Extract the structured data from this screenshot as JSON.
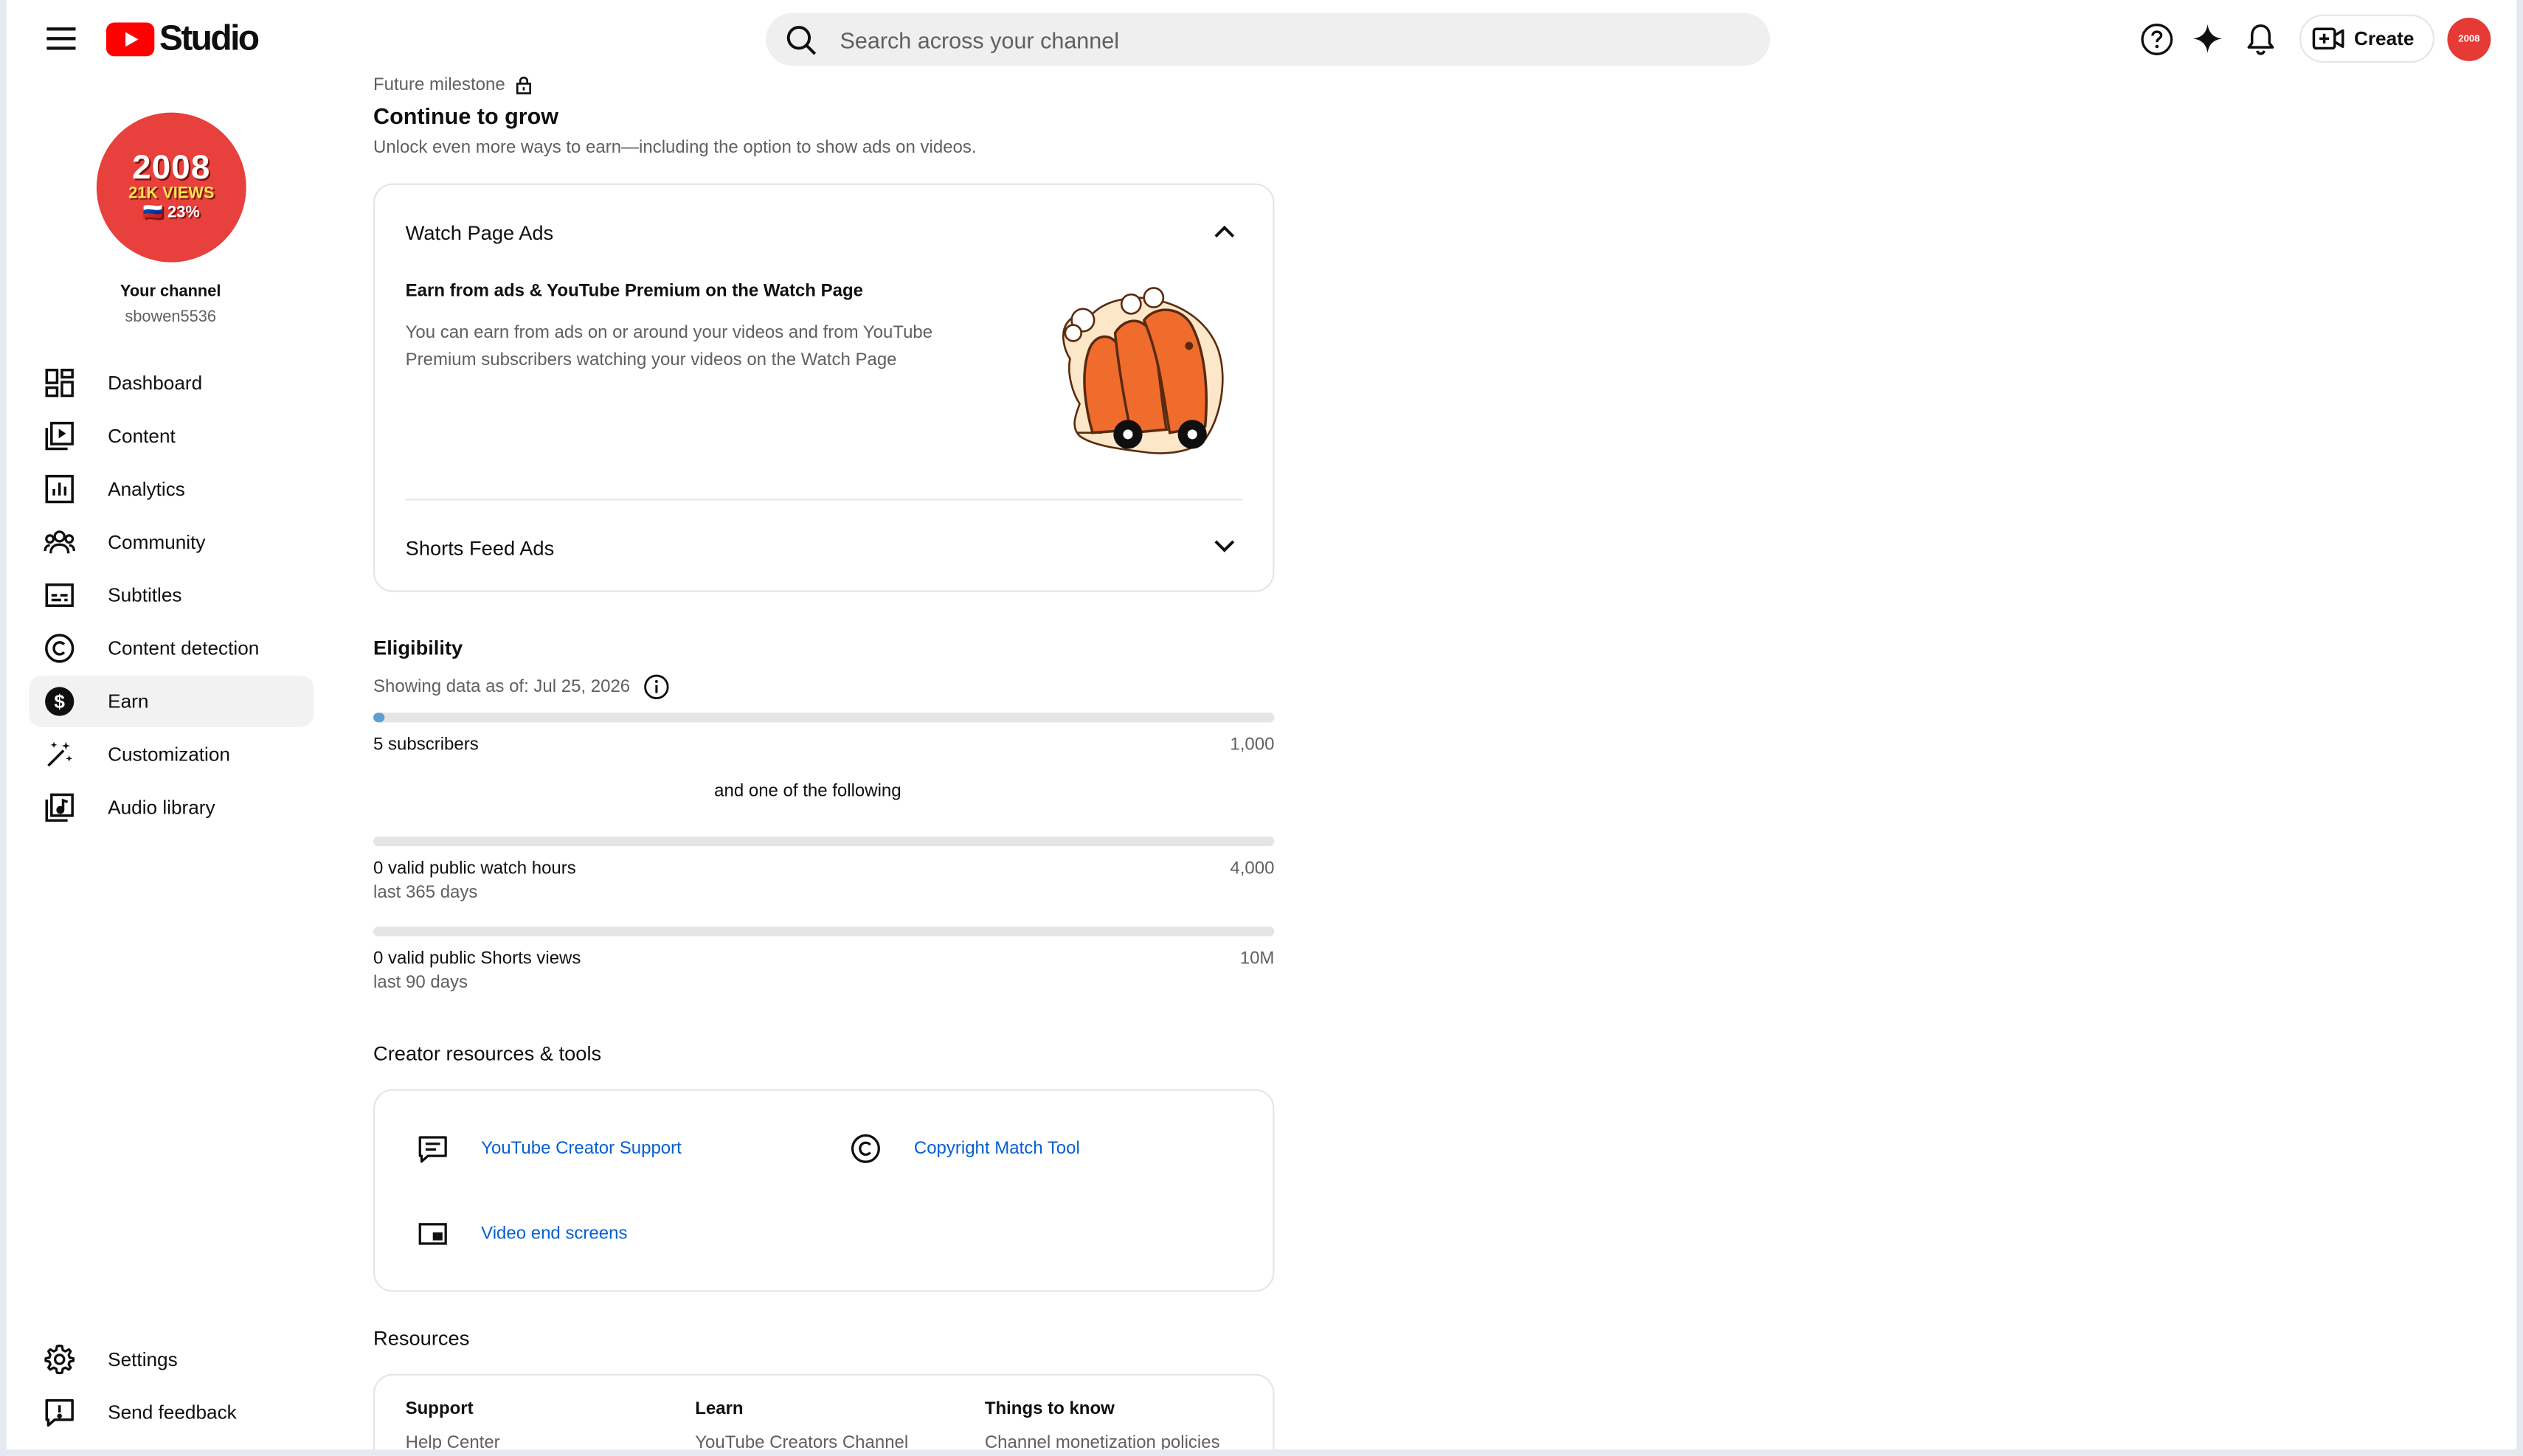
{
  "header": {
    "logo_text": "Studio",
    "search_placeholder": "Search across your channel",
    "create_label": "Create",
    "avatar_text": "2008"
  },
  "sidebar": {
    "avatar": {
      "line1": "2008",
      "line2": "21K VIEWS",
      "line3": "🇷🇺 23%"
    },
    "channel_title": "Your channel",
    "channel_handle": "sbowen5536",
    "items": [
      {
        "label": "Dashboard",
        "icon": "dashboard-icon"
      },
      {
        "label": "Content",
        "icon": "content-icon"
      },
      {
        "label": "Analytics",
        "icon": "analytics-icon"
      },
      {
        "label": "Community",
        "icon": "community-icon"
      },
      {
        "label": "Subtitles",
        "icon": "subtitles-icon"
      },
      {
        "label": "Content detection",
        "icon": "copyright-icon"
      },
      {
        "label": "Earn",
        "icon": "earn-icon",
        "active": true
      },
      {
        "label": "Customization",
        "icon": "magic-wand-icon"
      },
      {
        "label": "Audio library",
        "icon": "audio-library-icon"
      }
    ],
    "bottom_items": [
      {
        "label": "Settings",
        "icon": "gear-icon"
      },
      {
        "label": "Send feedback",
        "icon": "feedback-icon"
      }
    ]
  },
  "main": {
    "milestone_label": "Future milestone",
    "milestone_title": "Continue to grow",
    "milestone_desc": "Unlock even more ways to earn—including the option to show ads on videos.",
    "ads_card": {
      "section1_title": "Watch Page Ads",
      "section1_subtitle": "Earn from ads & YouTube Premium on the Watch Page",
      "section1_body": "You can earn from ads on or around your videos and from YouTube Premium subscribers watching your videos on the Watch Page",
      "section2_title": "Shorts Feed Ads"
    },
    "eligibility": {
      "title": "Eligibility",
      "data_as_of": "Showing data as of: Jul 25, 2026",
      "subscribers": {
        "label": "5 subscribers",
        "target": "1,000",
        "progress": 0.005
      },
      "or_text": "and one of the following",
      "watch_hours": {
        "label": "0 valid public watch hours",
        "period": "last 365 days",
        "target": "4,000",
        "progress": 0
      },
      "shorts_views": {
        "label": "0 valid public Shorts views",
        "period": "last 90 days",
        "target": "10M",
        "progress": 0
      }
    },
    "tools": {
      "title": "Creator resources & tools",
      "items": [
        {
          "label": "YouTube Creator Support",
          "icon": "message-icon"
        },
        {
          "label": "Copyright Match Tool",
          "icon": "copyright-icon"
        },
        {
          "label": "Video end screens",
          "icon": "end-screen-icon"
        }
      ]
    },
    "resources": {
      "title": "Resources",
      "columns": [
        {
          "heading": "Support",
          "first_link": "Help Center"
        },
        {
          "heading": "Learn",
          "first_link": "YouTube Creators Channel"
        },
        {
          "heading": "Things to know",
          "first_link": "Channel monetization policies"
        }
      ]
    }
  },
  "colors": {
    "brand_red": "#ff0000",
    "link_blue": "#065fd4",
    "progress_blue": "#5e9fd1",
    "active_nav_bg": "#f2f2f2"
  }
}
